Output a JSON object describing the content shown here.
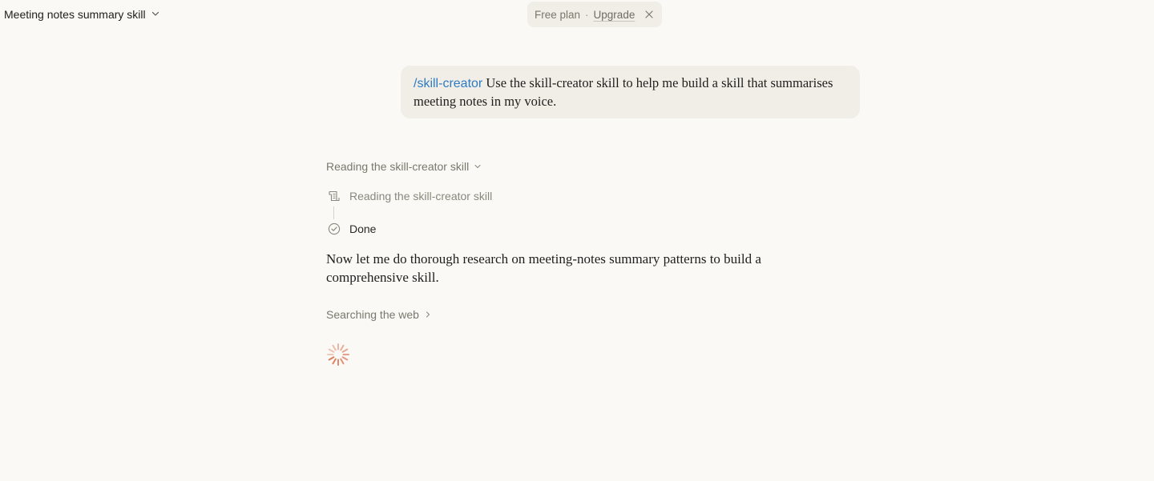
{
  "header": {
    "title": "Meeting notes summary skill",
    "title_icon": "chevron-down-icon"
  },
  "plan_banner": {
    "plan_label": "Free plan",
    "separator": "·",
    "upgrade_label": "Upgrade",
    "close_icon": "close-icon"
  },
  "user_message": {
    "command": "/skill-creator",
    "text": "Use the skill-creator skill to help me build a skill that summarises meeting notes in my voice.",
    "command_color": "#2e7bc4"
  },
  "assistant": {
    "thinking_label": "Reading the skill-creator skill",
    "steps": [
      {
        "label": "Reading the skill-creator skill",
        "icon": "scroll-icon"
      },
      {
        "label": "Done",
        "icon": "check-circle-icon"
      }
    ],
    "reply": "Now let me do thorough research on meeting-notes summary patterns to build a comprehensive skill.",
    "search_label": "Searching the web",
    "spinner_color": "#d97757"
  }
}
